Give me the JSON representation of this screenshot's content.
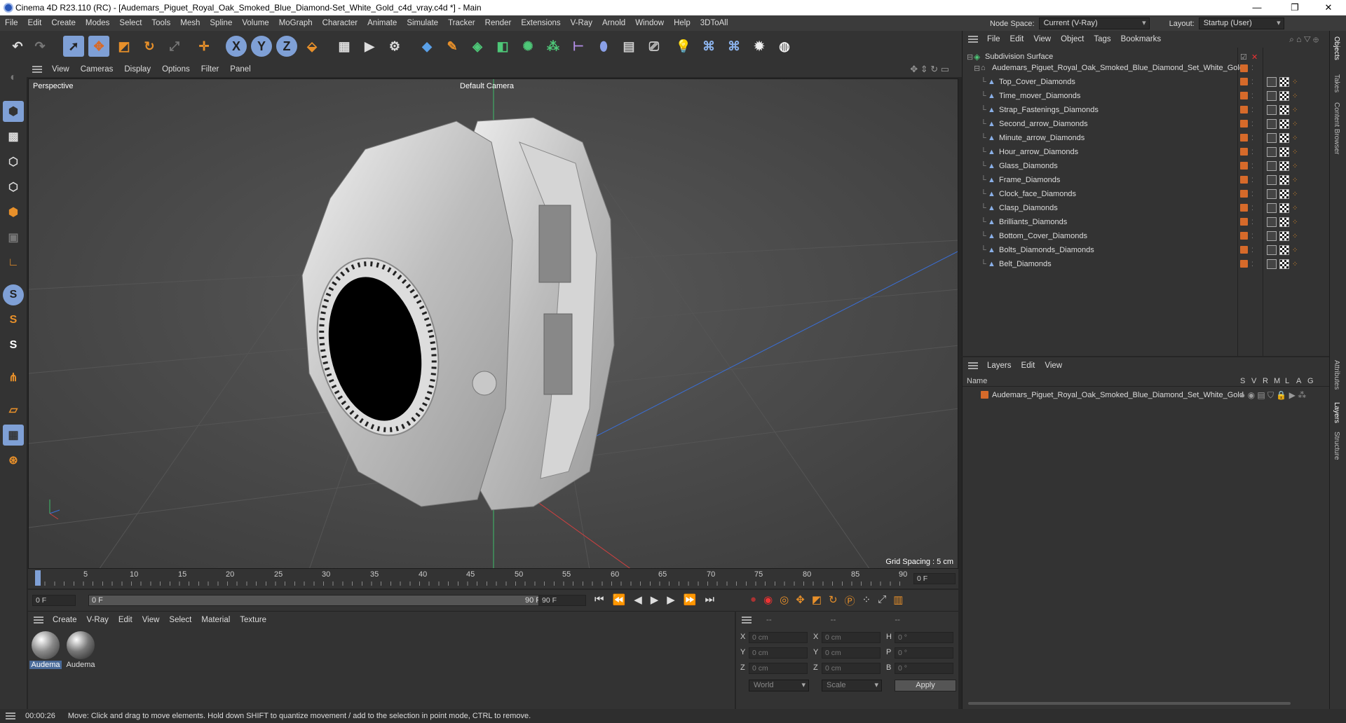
{
  "window": {
    "title": "Cinema 4D R23.110 (RC) - [Audemars_Piguet_Royal_Oak_Smoked_Blue_Diamond-Set_White_Gold_c4d_vray.c4d *] - Main",
    "minimize": "—",
    "maximize": "❐",
    "close": "✕"
  },
  "menubar": [
    "File",
    "Edit",
    "Create",
    "Modes",
    "Select",
    "Tools",
    "Mesh",
    "Spline",
    "Volume",
    "MoGraph",
    "Character",
    "Animate",
    "Simulate",
    "Tracker",
    "Render",
    "Extensions",
    "V-Ray",
    "Arnold",
    "Window",
    "Help",
    "3DToAll"
  ],
  "nodespace": {
    "label": "Node Space:",
    "value": "Current (V-Ray)"
  },
  "layout": {
    "label": "Layout:",
    "value": "Startup (User)"
  },
  "viewport": {
    "menu": [
      "View",
      "Cameras",
      "Display",
      "Options",
      "Filter",
      "Panel"
    ],
    "label": "Perspective",
    "camera": "Default Camera",
    "grid_spacing": "Grid Spacing : 5 cm"
  },
  "timeline": {
    "ticks": [
      "0",
      "5",
      "10",
      "15",
      "20",
      "25",
      "30",
      "35",
      "40",
      "45",
      "50",
      "55",
      "60",
      "65",
      "70",
      "75",
      "80",
      "85",
      "90"
    ],
    "current_frame": "0 F"
  },
  "transport": {
    "start": "0 F",
    "range_start": "0 F",
    "range_end": "90 F",
    "end": "90 F"
  },
  "material_manager": {
    "menu": [
      "Create",
      "V-Ray",
      "Edit",
      "View",
      "Select",
      "Material",
      "Texture"
    ],
    "materials": [
      {
        "name": "Audema"
      },
      {
        "name": "Audema"
      }
    ]
  },
  "coordinates": {
    "headers": [
      "--",
      "--",
      "--"
    ],
    "rows": [
      {
        "a": "X",
        "av": "0 cm",
        "b": "X",
        "bv": "0 cm",
        "c": "H",
        "cv": "0 °"
      },
      {
        "a": "Y",
        "av": "0 cm",
        "b": "Y",
        "bv": "0 cm",
        "c": "P",
        "cv": "0 °"
      },
      {
        "a": "Z",
        "av": "0 cm",
        "b": "Z",
        "bv": "0 cm",
        "c": "B",
        "cv": "0 °"
      }
    ],
    "mode": "World",
    "scale": "Scale",
    "apply": "Apply"
  },
  "object_manager": {
    "menu": [
      "File",
      "Edit",
      "View",
      "Object",
      "Tags",
      "Bookmarks"
    ],
    "root": "Subdivision Surface",
    "group": "Audemars_Piguet_Royal_Oak_Smoked_Blue_Diamond_Set_White_Gold",
    "children": [
      "Top_Cover_Diamonds",
      "Time_mover_Diamonds",
      "Strap_Fastenings_Diamonds",
      "Second_arrow_Diamonds",
      "Minute_arrow_Diamonds",
      "Hour_arrow_Diamonds",
      "Glass_Diamonds",
      "Frame_Diamonds",
      "Clock_face_Diamonds",
      "Clasp_Diamonds",
      "Brilliants_Diamonds",
      "Bottom_Cover_Diamonds",
      "Bolts_Diamonds_Diamonds",
      "Belt_Diamonds"
    ]
  },
  "layer_manager": {
    "menu": [
      "Layers",
      "Edit",
      "View"
    ],
    "columns": {
      "name": "Name",
      "flags": [
        "S",
        "V",
        "R",
        "M",
        "L",
        "A",
        "G"
      ]
    },
    "layers": [
      "Audemars_Piguet_Royal_Oak_Smoked_Blue_Diamond_Set_White_Gold"
    ]
  },
  "right_tabs": [
    "Objects",
    "Takes",
    "Content Browser",
    "Attributes",
    "Layers",
    "Structure"
  ],
  "status": {
    "time": "00:00:26",
    "message": "Move: Click and drag to move elements. Hold down SHIFT to quantize movement / add to the selection in point mode, CTRL to remove."
  },
  "colors": {
    "accent": "#d66a2a",
    "selection": "#4a6b99",
    "toolbar_active": "#7fa0d6"
  }
}
